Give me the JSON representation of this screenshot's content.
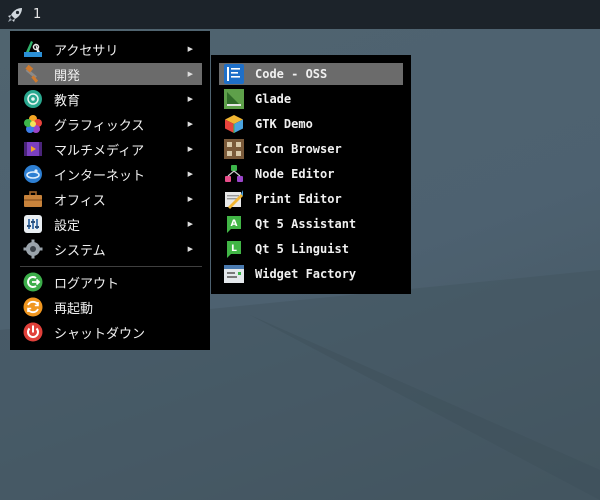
{
  "taskbar": {
    "workspace_label": "1"
  },
  "menu": {
    "items": [
      {
        "label": "アクセサリ",
        "icon": "accessories-icon"
      },
      {
        "label": "開発",
        "icon": "development-icon"
      },
      {
        "label": "教育",
        "icon": "education-icon"
      },
      {
        "label": "グラフィックス",
        "icon": "graphics-icon"
      },
      {
        "label": "マルチメディア",
        "icon": "multimedia-icon"
      },
      {
        "label": "インターネット",
        "icon": "internet-icon"
      },
      {
        "label": "オフィス",
        "icon": "office-icon"
      },
      {
        "label": "設定",
        "icon": "settings-icon"
      },
      {
        "label": "システム",
        "icon": "system-icon"
      }
    ],
    "actions": [
      {
        "label": "ログアウト",
        "icon": "logout-icon"
      },
      {
        "label": "再起動",
        "icon": "reboot-icon"
      },
      {
        "label": "シャットダウン",
        "icon": "shutdown-icon"
      }
    ],
    "submenu_arrow": "▶"
  },
  "submenu": {
    "items": [
      {
        "label": "Code - OSS",
        "icon": "code-oss-icon"
      },
      {
        "label": "Glade",
        "icon": "glade-icon"
      },
      {
        "label": "GTK Demo",
        "icon": "gtk-demo-icon"
      },
      {
        "label": "Icon Browser",
        "icon": "icon-browser-icon"
      },
      {
        "label": "Node Editor",
        "icon": "node-editor-icon"
      },
      {
        "label": "Print Editor",
        "icon": "print-editor-icon"
      },
      {
        "label": "Qt 5 Assistant",
        "icon": "qt-assistant-icon"
      },
      {
        "label": "Qt 5 Linguist",
        "icon": "qt-linguist-icon"
      },
      {
        "label": "Widget Factory",
        "icon": "widget-factory-icon"
      }
    ]
  },
  "colors": {
    "menu_bg": "#000000",
    "highlight": "#6b6b6b",
    "taskbar_bg": "#1c232a",
    "desktop": "#4d6170"
  }
}
